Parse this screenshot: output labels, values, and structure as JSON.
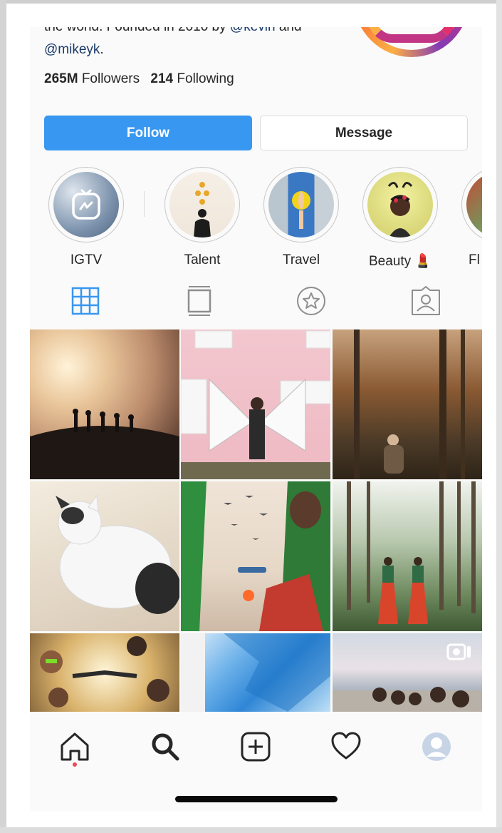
{
  "profile": {
    "bio_line1": "the world. Founded in 2010 by ",
    "bio_mention1": "@kevin",
    "bio_and": " and",
    "bio_mention2": "@mikeyk",
    "bio_period": ".",
    "followers_count": "265M",
    "followers_label": "Followers",
    "following_count": "214",
    "following_label": "Following"
  },
  "actions": {
    "follow_label": "Follow",
    "message_label": "Message"
  },
  "highlights": [
    {
      "label": "IGTV"
    },
    {
      "label": "Talent"
    },
    {
      "label": "Travel"
    },
    {
      "label": "Beauty 💄"
    },
    {
      "label": "Fl"
    }
  ],
  "tabs": [
    {
      "icon": "grid-icon",
      "active": true
    },
    {
      "icon": "igtv-tab-icon",
      "active": false
    },
    {
      "icon": "star-badge-icon",
      "active": false
    },
    {
      "icon": "tagged-icon",
      "active": false
    }
  ],
  "nav": [
    {
      "icon": "home-icon"
    },
    {
      "icon": "search-icon"
    },
    {
      "icon": "add-post-icon"
    },
    {
      "icon": "heart-icon"
    },
    {
      "icon": "profile-icon"
    }
  ],
  "colors": {
    "accent": "#3897f0",
    "notification": "#ed4956",
    "text": "#262626",
    "link": "#1a3a6b"
  }
}
